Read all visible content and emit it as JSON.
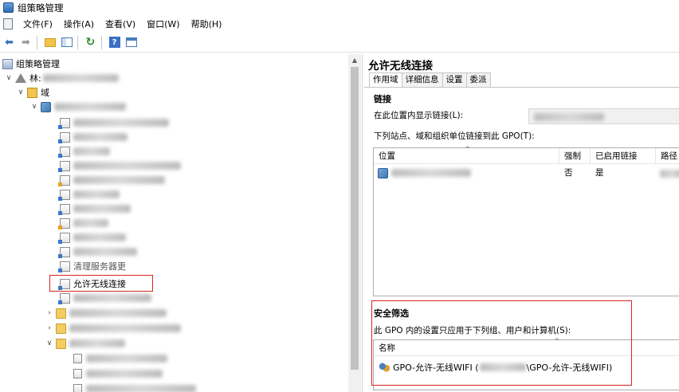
{
  "window": {
    "title": "组策略管理"
  },
  "menubar": {
    "items": [
      "文件(F)",
      "操作(A)",
      "查看(V)",
      "窗口(W)",
      "帮助(H)"
    ]
  },
  "toolbar": {
    "buttons": [
      "back-arrow-icon",
      "forward-arrow-icon",
      "up-folder-icon",
      "show-hide-tree-icon",
      "refresh-icon",
      "help-icon",
      "properties-icon"
    ]
  },
  "tree": {
    "root_label": "组策略管理",
    "forest_label": "林:",
    "domains_label": "域",
    "selected_gpo_label": "允许无线连接",
    "partial_gpo_label": "清理服务器更",
    "blurred_gpo_count": 11
  },
  "right": {
    "gpo_title": "允许无线连接",
    "tabs": [
      "作用域",
      "详细信息",
      "设置",
      "委派"
    ],
    "active_tab": "作用域",
    "links_heading": "链接",
    "display_links_label": "在此位置内显示链接(L):",
    "linked_label": "下列站点、域和组织单位链接到此 GPO(T):",
    "links_columns": [
      "位置",
      "强制",
      "已启用链接",
      "路径"
    ],
    "links_rows": [
      {
        "enforced": "否",
        "link_enabled": "是"
      }
    ],
    "security_heading": "安全筛选",
    "security_desc": "此 GPO 内的设置只应用于下列组、用户和计算机(S):",
    "filter_column": "名称",
    "filter_rows": [
      {
        "prefix": "GPO-允许-无线WIFI (",
        "suffix": "\\GPO-允许-无线WIFI)"
      }
    ]
  },
  "colors": {
    "highlight_border": "#d9231f",
    "accent": "#3470c0"
  }
}
